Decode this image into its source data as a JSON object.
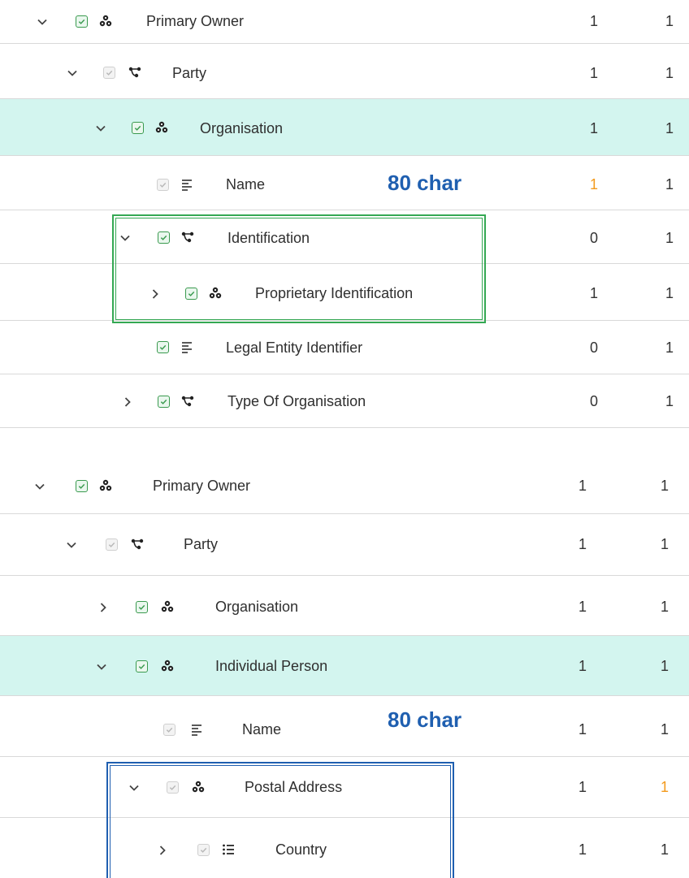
{
  "colors": {
    "highlight_row": "#d3f5ef",
    "orange_value": "#f39a1c",
    "annotation_blue": "#1f5fb0",
    "annotation_green": "#34a853",
    "checkbox_green": "#3a9a4f"
  },
  "panel1": {
    "rows": [
      {
        "label": "Primary Owner",
        "min": "1",
        "max": "1",
        "icon": "group-icon",
        "caret": "expanded"
      },
      {
        "label": "Party",
        "min": "1",
        "max": "1",
        "icon": "choice-branch-icon",
        "caret": "expanded"
      },
      {
        "label": "Organisation",
        "min": "1",
        "max": "1",
        "icon": "group-icon",
        "caret": "expanded"
      },
      {
        "label": "Name",
        "min": "1",
        "max": "1",
        "icon": "text-lines-icon",
        "caret": "none"
      },
      {
        "label": "Identification",
        "min": "0",
        "max": "1",
        "icon": "choice-branch-icon",
        "caret": "expanded"
      },
      {
        "label": "Proprietary Identification",
        "min": "1",
        "max": "1",
        "icon": "group-icon",
        "caret": "collapsed"
      },
      {
        "label": "Legal Entity Identifier",
        "min": "0",
        "max": "1",
        "icon": "text-lines-icon",
        "caret": "none"
      },
      {
        "label": "Type Of Organisation",
        "min": "0",
        "max": "1",
        "icon": "choice-branch-icon",
        "caret": "collapsed"
      }
    ],
    "annotation": "80 char"
  },
  "panel2": {
    "rows": [
      {
        "label": "Primary Owner",
        "min": "1",
        "max": "1",
        "icon": "group-icon",
        "caret": "expanded"
      },
      {
        "label": "Party",
        "min": "1",
        "max": "1",
        "icon": "choice-branch-icon",
        "caret": "expanded"
      },
      {
        "label": "Organisation",
        "min": "1",
        "max": "1",
        "icon": "group-icon",
        "caret": "collapsed"
      },
      {
        "label": "Individual Person",
        "min": "1",
        "max": "1",
        "icon": "group-icon",
        "caret": "expanded"
      },
      {
        "label": "Name",
        "min": "1",
        "max": "1",
        "icon": "text-lines-icon",
        "caret": "none"
      },
      {
        "label": "Postal Address",
        "min": "1",
        "max": "1",
        "icon": "group-icon",
        "caret": "expanded"
      },
      {
        "label": "Country",
        "min": "1",
        "max": "1",
        "icon": "list-icon",
        "caret": "collapsed"
      }
    ],
    "annotation": "80 char"
  }
}
